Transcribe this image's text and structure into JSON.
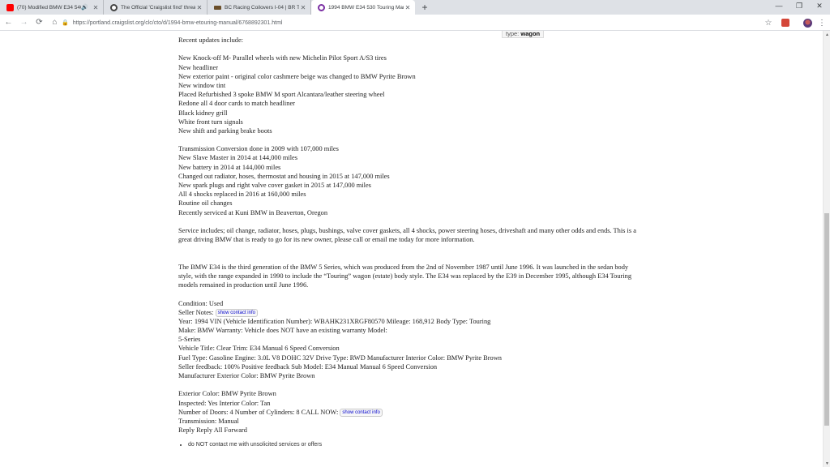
{
  "tabs": [
    {
      "title": "(70) Modified BMW E34 540i...",
      "favicon_color": "#ff0000",
      "audio": true
    },
    {
      "title": "The Official 'Craigslist find' thread",
      "favicon_color": "#444444",
      "audio": false
    },
    {
      "title": "BC Racing Coilovers I-04 | BR Typ...",
      "favicon_color": "#6b4f2a",
      "audio": false
    },
    {
      "title": "1994 BMW E34 530 Touring Man...",
      "favicon_color": "#7b2fa3",
      "audio": false
    }
  ],
  "toolbar": {
    "url": "https://portland.craigslist.org/clc/cto/d/1994-bmw-etouring-manual/6768892301.html"
  },
  "tooltip": {
    "label": "type:",
    "value": "wagon"
  },
  "content": {
    "recent_updates_heading": "Recent updates include:",
    "updates": [
      "New Knock-off M- Parallel wheels with new Michelin Pilot Sport A/S3 tires",
      "New headliner",
      "New exterior paint - original color cashmere beige was changed to BMW Pyrite Brown",
      "New window tint",
      "Placed Refurbished 3 spoke BMW M sport Alcantara/leather steering wheel",
      "Redone all 4 door cards to match headliner",
      "Black kidney grill",
      "White front turn signals",
      "New shift and parking brake boots"
    ],
    "maintenance": [
      "Transmission Conversion done in 2009 with 107,000 miles",
      "New Slave Master in 2014 at 144,000 miles",
      "New battery in 2014 at 144,000 miles",
      "Changed out radiator, hoses, thermostat and housing in 2015 at 147,000 miles",
      "New spark plugs and right valve cover gasket in 2015 at 147,000 miles",
      "All 4 shocks replaced in 2016 at 160,000 miles",
      "Routine oil changes",
      "Recently serviced at Kuni BMW in Beaverton, Oregon"
    ],
    "service_paragraph": "Service includes; oil change, radiator, hoses, plugs, bushings, valve cover gaskets, all 4 shocks, power steering hoses, driveshaft and many other odds and ends. This is a great driving BMW that is ready to go for its new owner, please call or email me today for more information.",
    "e34_paragraph": "The BMW E34 is the third generation of the BMW 5 Series, which was produced from the 2nd of November 1987 until June 1996. It was launched in the sedan body style, with the range expanded in 1990 to include the “Touring” wagon (estate) body style. The E34 was replaced by the E39 in December 1995, although E34 Touring models remained in production until June 1996.",
    "condition": "Condition: Used",
    "seller_notes_label": "Seller Notes:",
    "show_contact": "show contact info",
    "details": [
      "Year: 1994 VIN (Vehicle Identification Number): WBAHK231XRGF80570 Mileage: 168,912 Body Type: Touring",
      "Make: BMW Warranty: Vehicle does NOT have an existing warranty Model:",
      "5-Series",
      "Vehicle Title: Clear Trim: E34 Manual 6 Speed Conversion",
      "Fuel Type: Gasoline Engine: 3.0L V8 DOHC 32V Drive Type: RWD Manufacturer Interior Color: BMW Pyrite Brown",
      "Seller feedback: 100% Positive feedback Sub Model: E34 Manual Manual 6 Speed Conversion",
      "Manufacturer Exterior Color: BMW Pyrite Brown"
    ],
    "exterior_color": "Exterior Color: BMW Pyrite Brown",
    "inspected": "Inspected: Yes Interior Color: Tan",
    "doors_line": "Number of Doors: 4 Number of Cylinders: 8 CALL NOW:",
    "transmission": "Transmission: Manual",
    "reply_line": "Reply Reply All Forward",
    "bullets": [
      "do NOT contact me with unsolicited services or offers"
    ]
  }
}
